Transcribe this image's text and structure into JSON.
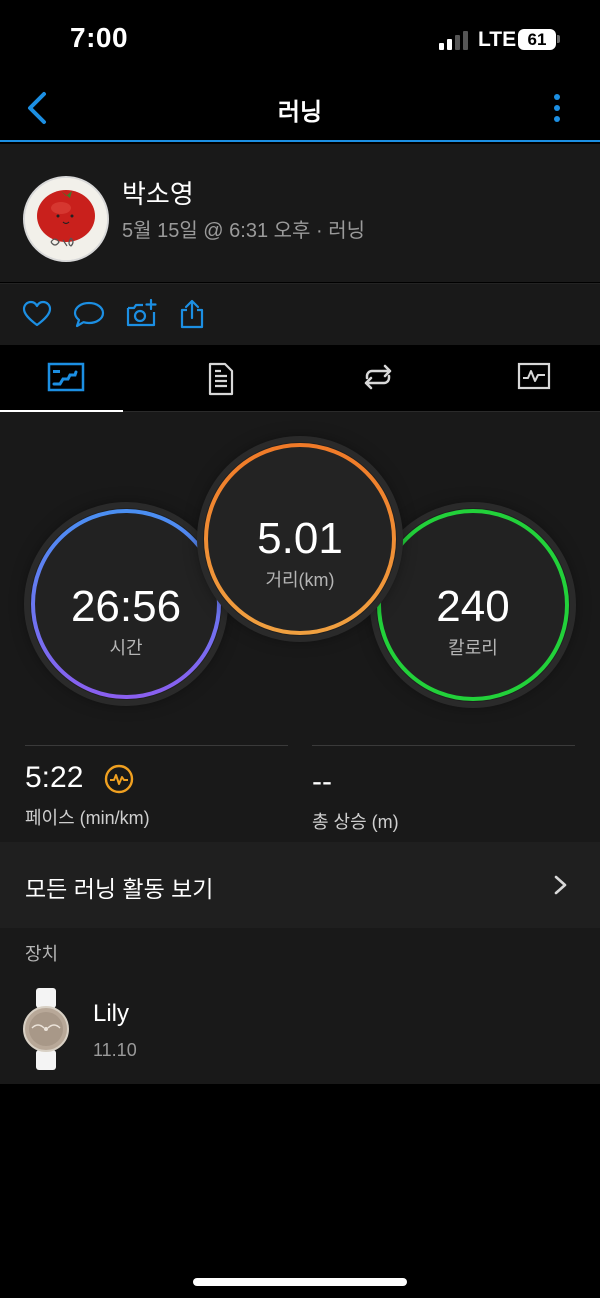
{
  "status_bar": {
    "time": "7:00",
    "network": "LTE",
    "battery": "61"
  },
  "nav": {
    "title": "러닝",
    "back_icon": "chevron-left-icon",
    "more_icon": "more-vertical-icon"
  },
  "profile": {
    "name": "박소영",
    "meta": "5월 15일 @ 6:31 오후 · 러닝"
  },
  "actions": [
    "heart-icon",
    "comment-icon",
    "add-photo-icon",
    "share-icon"
  ],
  "tabs": [
    "summary-tab-icon",
    "details-tab-icon",
    "laps-tab-icon",
    "charts-tab-icon"
  ],
  "stats": {
    "time": {
      "value": "26:56",
      "label": "시간",
      "color": "#4e8ff0"
    },
    "distance": {
      "value": "5.01",
      "label": "거리(km)",
      "color": "#f08a28"
    },
    "calories": {
      "value": "240",
      "label": "칼로리",
      "color": "#22d13a"
    }
  },
  "metrics": {
    "pace": {
      "value": "5:22",
      "label": "페이스 (min/km)",
      "icon": "pace-chart-icon"
    },
    "elevation": {
      "value": "--",
      "label": "총 상승 (m)"
    }
  },
  "all_runs": {
    "label": "모든 러닝 활동 보기"
  },
  "device": {
    "heading": "장치",
    "name": "Lily",
    "version": "11.10"
  },
  "colors": {
    "accent": "#1c8fe3",
    "pace_icon": "#f0a020"
  }
}
